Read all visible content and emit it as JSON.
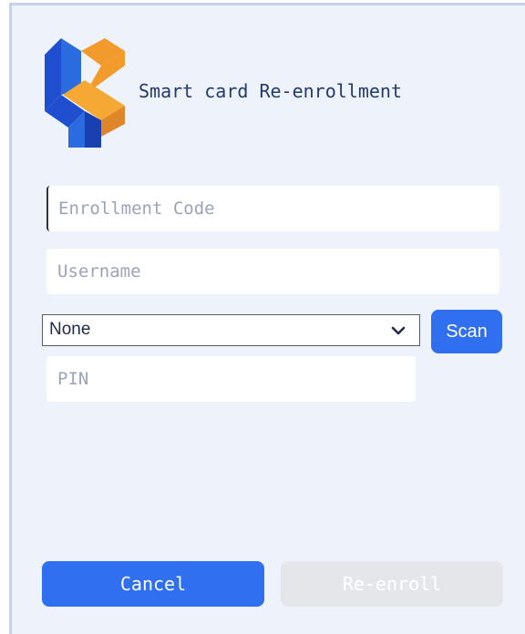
{
  "header": {
    "title": "Smart card Re-enrollment",
    "logo_icon": "kyvo-logo-icon"
  },
  "form": {
    "enrollment_code": {
      "value": "",
      "placeholder": "Enrollment Code"
    },
    "username": {
      "value": "",
      "placeholder": "Username"
    },
    "card_reader": {
      "selected": "None"
    },
    "scan_label": "Scan",
    "pin": {
      "value": "",
      "placeholder": "PIN"
    }
  },
  "actions": {
    "cancel_label": "Cancel",
    "reenroll_label": "Re-enroll",
    "reenroll_enabled": false
  },
  "colors": {
    "accent": "#2f6ff0",
    "background": "#eef2fb",
    "title": "#233a6b",
    "disabled": "#e4e6ea"
  }
}
